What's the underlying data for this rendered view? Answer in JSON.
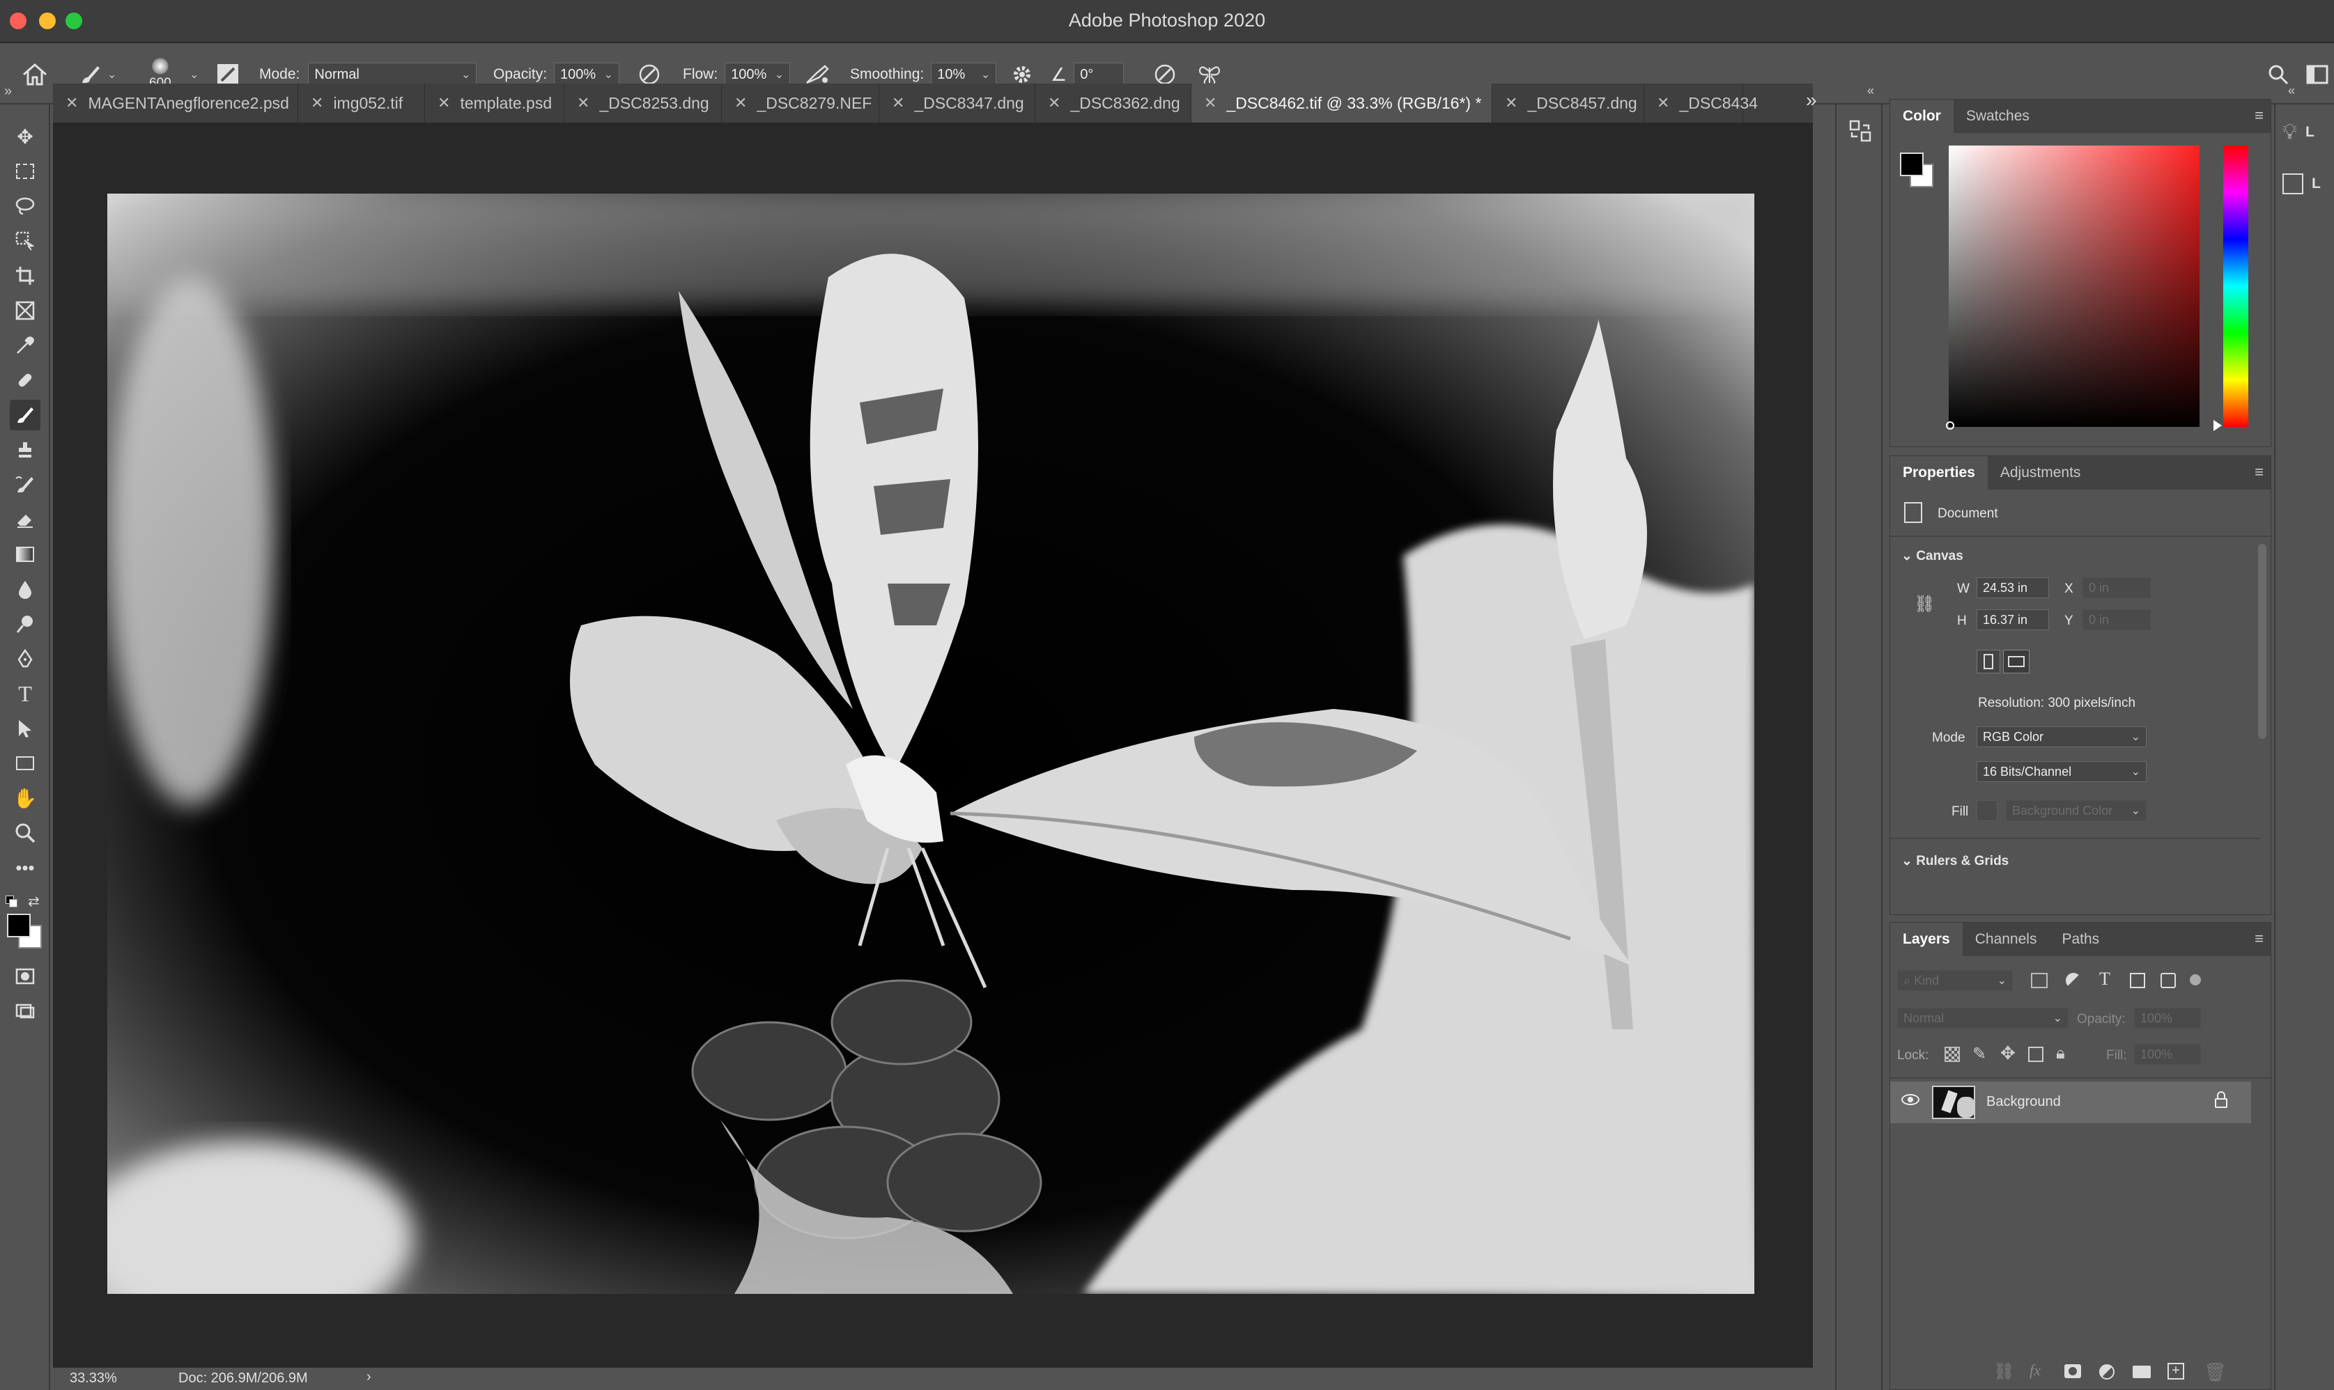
{
  "window": {
    "title": "Adobe Photoshop 2020"
  },
  "options_bar": {
    "brush_size": "600",
    "mode_label": "Mode:",
    "mode_value": "Normal",
    "opacity_label": "Opacity:",
    "opacity_value": "100%",
    "flow_label": "Flow:",
    "flow_value": "100%",
    "smoothing_label": "Smoothing:",
    "smoothing_value": "10%",
    "angle_value": "0°"
  },
  "tabs": [
    {
      "label": "MAGENTAnegflorence2.psd"
    },
    {
      "label": "img052.tif"
    },
    {
      "label": "template.psd"
    },
    {
      "label": "_DSC8253.dng"
    },
    {
      "label": "_DSC8279.NEF"
    },
    {
      "label": "_DSC8347.dng"
    },
    {
      "label": "_DSC8362.dng"
    },
    {
      "label": "_DSC8462.tif @ 33.3% (RGB/16*) *"
    },
    {
      "label": "_DSC8457.dng"
    },
    {
      "label": "_DSC8434"
    }
  ],
  "status": {
    "zoom": "33.33%",
    "doc": "Doc: 206.9M/206.9M"
  },
  "color_panel": {
    "tab_color": "Color",
    "tab_swatches": "Swatches",
    "fg": "#000000",
    "bg": "#ffffff"
  },
  "properties_panel": {
    "tab_properties": "Properties",
    "tab_adjustments": "Adjustments",
    "document_label": "Document",
    "canvas_section": "Canvas",
    "w_label": "W",
    "w_value": "24.53 in",
    "h_label": "H",
    "h_value": "16.37 in",
    "x_label": "X",
    "x_value": "0 in",
    "y_label": "Y",
    "y_value": "0 in",
    "resolution": "Resolution: 300 pixels/inch",
    "mode_label": "Mode",
    "mode_value": "RGB Color",
    "depth_value": "16 Bits/Channel",
    "fill_label": "Fill",
    "fill_value": "Background Color",
    "rulers_section": "Rulers & Grids"
  },
  "layers_panel": {
    "tab_layers": "Layers",
    "tab_channels": "Channels",
    "tab_paths": "Paths",
    "kind_placeholder": "Kind",
    "blend_mode": "Normal",
    "opacity_label": "Opacity:",
    "opacity_value": "100%",
    "lock_label": "Lock:",
    "fill_label": "Fill:",
    "fill_value": "100%",
    "layers": [
      {
        "name": "Background"
      }
    ]
  },
  "right_edge": {
    "item1": "L",
    "item2": "L"
  }
}
